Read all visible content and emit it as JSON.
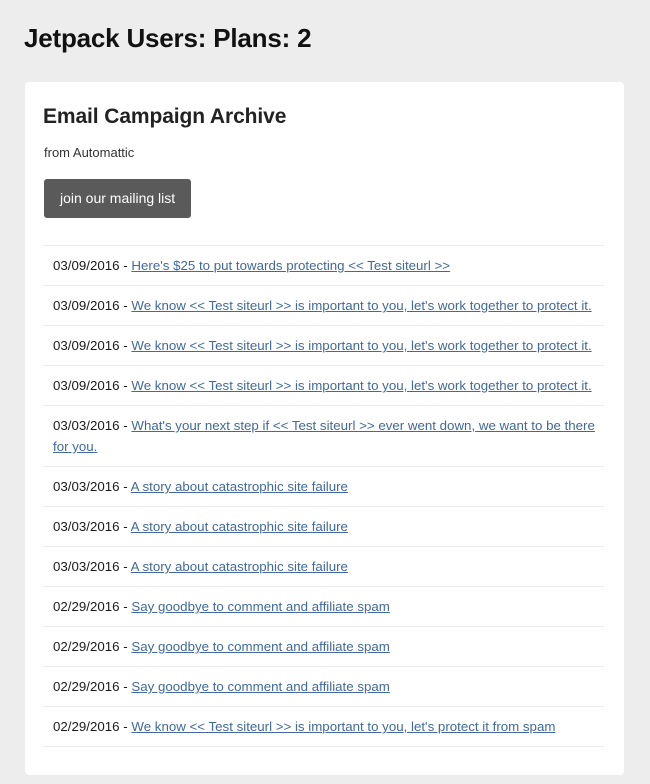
{
  "page": {
    "title": "Jetpack Users: Plans: 2",
    "background_color": "#ededed",
    "card_background_color": "#ffffff"
  },
  "card": {
    "heading": "Email Campaign Archive",
    "subtitle": "from Automattic",
    "join_button_label": "join our mailing list",
    "join_button_color": "#5a5a5a",
    "link_color": "#41699c",
    "separator": "-"
  },
  "archive": {
    "items": [
      {
        "date": "03/09/2016",
        "title": "Here's $25 to put towards protecting << Test siteurl >>"
      },
      {
        "date": "03/09/2016",
        "title": "We know << Test siteurl >> is important to you, let's work together to protect it."
      },
      {
        "date": "03/09/2016",
        "title": "We know << Test siteurl >> is important to you, let's work together to protect it."
      },
      {
        "date": "03/09/2016",
        "title": "We know << Test siteurl >> is important to you, let's work together to protect it."
      },
      {
        "date": "03/03/2016",
        "title": "What's your next step if << Test siteurl >> ever went down, we want to be there for you. "
      },
      {
        "date": "03/03/2016",
        "title": "A story about catastrophic site failure"
      },
      {
        "date": "03/03/2016",
        "title": "A story about catastrophic site failure"
      },
      {
        "date": "03/03/2016",
        "title": "A story about catastrophic site failure"
      },
      {
        "date": "02/29/2016",
        "title": "Say goodbye to comment and affiliate spam"
      },
      {
        "date": "02/29/2016",
        "title": "Say goodbye to comment and affiliate spam"
      },
      {
        "date": "02/29/2016",
        "title": "Say goodbye to comment and affiliate spam"
      },
      {
        "date": "02/29/2016",
        "title": "We know << Test siteurl >> is important to you, let's protect it from spam"
      }
    ]
  }
}
